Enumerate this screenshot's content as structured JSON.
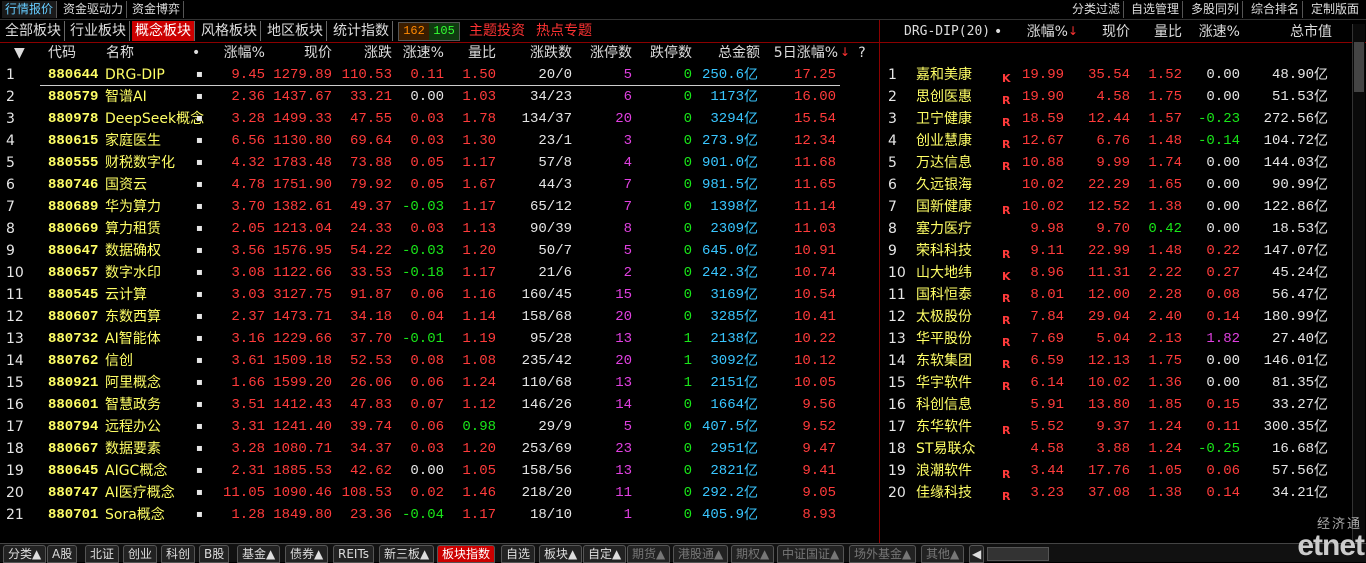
{
  "top_tabs": [
    "行情报价",
    "资金驱动力",
    "资金博弈"
  ],
  "top_right_tabs": [
    "分类过滤",
    "自选管理",
    "多股同列",
    "综合排名",
    "定制版面"
  ],
  "sec_tabs": [
    "全部板块",
    "行业板块",
    "概念板块",
    "风格板块",
    "地区板块",
    "统计指数"
  ],
  "sec_active": "概念板块",
  "sec_up_count": "162",
  "sec_down_count": "105",
  "sec_red_tabs": [
    "主题投资",
    "热点专题"
  ],
  "left_headers": {
    "sort": "▼",
    "code": "代码",
    "name": "名称",
    "dot": "•",
    "pct": "涨幅%",
    "price": "现价",
    "chg": "涨跌",
    "speed": "涨速%",
    "ratio": "量比",
    "updown": "涨跌数",
    "limitup": "涨停数",
    "limitdown": "跌停数",
    "amount": "总金额",
    "pct5": "5日涨幅%",
    "q": "?"
  },
  "left_rows": [
    {
      "idx": "1",
      "code": "880644",
      "name": "DRG-DIP",
      "pct": "9.45",
      "price": "1279.89",
      "chg": "110.53",
      "speed": "0.11",
      "ratio": "1.50",
      "updown": "20/0",
      "limitup": "5",
      "limitdown": "0",
      "amount": "250.6",
      "unit": "亿",
      "pct5": "17.25"
    },
    {
      "idx": "2",
      "code": "880579",
      "name": "智谱AI",
      "pct": "2.36",
      "price": "1437.67",
      "chg": "33.21",
      "speed": "0.00",
      "ratio": "1.03",
      "updown": "34/23",
      "limitup": "6",
      "limitdown": "0",
      "amount": "1173",
      "unit": "亿",
      "pct5": "16.00"
    },
    {
      "idx": "3",
      "code": "880978",
      "name": "DeepSeek概念",
      "pct": "3.28",
      "price": "1499.33",
      "chg": "47.55",
      "speed": "0.03",
      "ratio": "1.78",
      "updown": "134/37",
      "limitup": "20",
      "limitdown": "0",
      "amount": "3294",
      "unit": "亿",
      "pct5": "15.54"
    },
    {
      "idx": "4",
      "code": "880615",
      "name": "家庭医生",
      "pct": "6.56",
      "price": "1130.80",
      "chg": "69.64",
      "speed": "0.03",
      "ratio": "1.30",
      "updown": "23/1",
      "limitup": "3",
      "limitdown": "0",
      "amount": "273.9",
      "unit": "亿",
      "pct5": "12.34"
    },
    {
      "idx": "5",
      "code": "880555",
      "name": "财税数字化",
      "pct": "4.32",
      "price": "1783.48",
      "chg": "73.88",
      "speed": "0.05",
      "ratio": "1.17",
      "updown": "57/8",
      "limitup": "4",
      "limitdown": "0",
      "amount": "901.0",
      "unit": "亿",
      "pct5": "11.68"
    },
    {
      "idx": "6",
      "code": "880746",
      "name": "国资云",
      "pct": "4.78",
      "price": "1751.90",
      "chg": "79.92",
      "speed": "0.05",
      "ratio": "1.67",
      "updown": "44/3",
      "limitup": "7",
      "limitdown": "0",
      "amount": "981.5",
      "unit": "亿",
      "pct5": "11.65"
    },
    {
      "idx": "7",
      "code": "880689",
      "name": "华为算力",
      "pct": "3.70",
      "price": "1382.61",
      "chg": "49.37",
      "speed": "-0.03",
      "ratio": "1.17",
      "updown": "65/12",
      "limitup": "7",
      "limitdown": "0",
      "amount": "1398",
      "unit": "亿",
      "pct5": "11.14"
    },
    {
      "idx": "8",
      "code": "880669",
      "name": "算力租赁",
      "pct": "2.05",
      "price": "1213.04",
      "chg": "24.33",
      "speed": "0.03",
      "ratio": "1.13",
      "updown": "90/39",
      "limitup": "8",
      "limitdown": "0",
      "amount": "2309",
      "unit": "亿",
      "pct5": "11.03"
    },
    {
      "idx": "9",
      "code": "880647",
      "name": "数据确权",
      "pct": "3.56",
      "price": "1576.95",
      "chg": "54.22",
      "speed": "-0.03",
      "ratio": "1.20",
      "updown": "50/7",
      "limitup": "5",
      "limitdown": "0",
      "amount": "645.0",
      "unit": "亿",
      "pct5": "10.91"
    },
    {
      "idx": "10",
      "code": "880657",
      "name": "数字水印",
      "pct": "3.08",
      "price": "1122.66",
      "chg": "33.53",
      "speed": "-0.18",
      "ratio": "1.17",
      "updown": "21/6",
      "limitup": "2",
      "limitdown": "0",
      "amount": "242.3",
      "unit": "亿",
      "pct5": "10.74"
    },
    {
      "idx": "11",
      "code": "880545",
      "name": "云计算",
      "pct": "3.03",
      "price": "3127.75",
      "chg": "91.87",
      "speed": "0.06",
      "ratio": "1.16",
      "updown": "160/45",
      "limitup": "15",
      "limitdown": "0",
      "amount": "3169",
      "unit": "亿",
      "pct5": "10.54"
    },
    {
      "idx": "12",
      "code": "880607",
      "name": "东数西算",
      "pct": "2.37",
      "price": "1473.71",
      "chg": "34.18",
      "speed": "0.04",
      "ratio": "1.14",
      "updown": "158/68",
      "limitup": "20",
      "limitdown": "0",
      "amount": "3285",
      "unit": "亿",
      "pct5": "10.41"
    },
    {
      "idx": "13",
      "code": "880732",
      "name": "AI智能体",
      "pct": "3.16",
      "price": "1229.66",
      "chg": "37.70",
      "speed": "-0.01",
      "ratio": "1.19",
      "updown": "95/28",
      "limitup": "13",
      "limitdown": "1",
      "amount": "2138",
      "unit": "亿",
      "pct5": "10.22"
    },
    {
      "idx": "14",
      "code": "880762",
      "name": "信创",
      "pct": "3.61",
      "price": "1509.18",
      "chg": "52.53",
      "speed": "0.08",
      "ratio": "1.08",
      "updown": "235/42",
      "limitup": "20",
      "limitdown": "1",
      "amount": "3092",
      "unit": "亿",
      "pct5": "10.12"
    },
    {
      "idx": "15",
      "code": "880921",
      "name": "阿里概念",
      "pct": "1.66",
      "price": "1599.20",
      "chg": "26.06",
      "speed": "0.06",
      "ratio": "1.24",
      "updown": "110/68",
      "limitup": "13",
      "limitdown": "1",
      "amount": "2151",
      "unit": "亿",
      "pct5": "10.05"
    },
    {
      "idx": "16",
      "code": "880601",
      "name": "智慧政务",
      "pct": "3.51",
      "price": "1412.43",
      "chg": "47.83",
      "speed": "0.07",
      "ratio": "1.12",
      "updown": "146/26",
      "limitup": "14",
      "limitdown": "0",
      "amount": "1664",
      "unit": "亿",
      "pct5": "9.56"
    },
    {
      "idx": "17",
      "code": "880794",
      "name": "远程办公",
      "pct": "3.31",
      "price": "1241.40",
      "chg": "39.74",
      "speed": "0.06",
      "ratio": "0.98",
      "updown": "29/9",
      "limitup": "5",
      "limitdown": "0",
      "amount": "407.5",
      "unit": "亿",
      "pct5": "9.52"
    },
    {
      "idx": "18",
      "code": "880667",
      "name": "数据要素",
      "pct": "3.28",
      "price": "1080.71",
      "chg": "34.37",
      "speed": "0.03",
      "ratio": "1.20",
      "updown": "253/69",
      "limitup": "23",
      "limitdown": "0",
      "amount": "2951",
      "unit": "亿",
      "pct5": "9.47"
    },
    {
      "idx": "19",
      "code": "880645",
      "name": "AIGC概念",
      "pct": "2.31",
      "price": "1885.53",
      "chg": "42.62",
      "speed": "0.00",
      "ratio": "1.05",
      "updown": "158/56",
      "limitup": "13",
      "limitdown": "0",
      "amount": "2821",
      "unit": "亿",
      "pct5": "9.41"
    },
    {
      "idx": "20",
      "code": "880747",
      "name": "AI医疗概念",
      "pct": "11.05",
      "price": "1090.46",
      "chg": "108.53",
      "speed": "0.02",
      "ratio": "1.46",
      "updown": "218/20",
      "limitup": "11",
      "limitdown": "0",
      "amount": "292.2",
      "unit": "亿",
      "pct5": "9.05"
    },
    {
      "idx": "21",
      "code": "880701",
      "name": "Sora概念",
      "pct": "1.28",
      "price": "1849.80",
      "chg": "23.36",
      "speed": "-0.04",
      "ratio": "1.17",
      "updown": "18/10",
      "limitup": "1",
      "limitdown": "0",
      "amount": "405.9",
      "unit": "亿",
      "pct5": "8.93"
    }
  ],
  "right_headers": {
    "title": "DRG-DIP(20)",
    "dot": "•",
    "pct": "涨幅%",
    "price": "现价",
    "ratio": "量比",
    "speed": "涨速%",
    "cap": "总市值"
  },
  "right_rows": [
    {
      "idx": "1",
      "name": "嘉和美康",
      "flag": "K",
      "pct": "19.99",
      "price": "35.54",
      "ratio": "1.52",
      "speed": "0.00",
      "cap": "48.90",
      "unit": "亿"
    },
    {
      "idx": "2",
      "name": "思创医惠",
      "flag": "R",
      "pct": "19.90",
      "price": "4.58",
      "ratio": "1.75",
      "speed": "0.00",
      "cap": "51.53",
      "unit": "亿"
    },
    {
      "idx": "3",
      "name": "卫宁健康",
      "flag": "R",
      "pct": "18.59",
      "price": "12.44",
      "ratio": "1.57",
      "speed": "-0.23",
      "cap": "272.56",
      "unit": "亿"
    },
    {
      "idx": "4",
      "name": "创业慧康",
      "flag": "R",
      "pct": "12.67",
      "price": "6.76",
      "ratio": "1.48",
      "speed": "-0.14",
      "cap": "104.72",
      "unit": "亿"
    },
    {
      "idx": "5",
      "name": "万达信息",
      "flag": "R",
      "pct": "10.88",
      "price": "9.99",
      "ratio": "1.74",
      "speed": "0.00",
      "cap": "144.03",
      "unit": "亿"
    },
    {
      "idx": "6",
      "name": "久远银海",
      "flag": "",
      "pct": "10.02",
      "price": "22.29",
      "ratio": "1.65",
      "speed": "0.00",
      "cap": "90.99",
      "unit": "亿"
    },
    {
      "idx": "7",
      "name": "国新健康",
      "flag": "R",
      "pct": "10.02",
      "price": "12.52",
      "ratio": "1.38",
      "speed": "0.00",
      "cap": "122.86",
      "unit": "亿"
    },
    {
      "idx": "8",
      "name": "塞力医疗",
      "flag": "",
      "pct": "9.98",
      "price": "9.70",
      "ratio": "0.42",
      "speed": "0.00",
      "cap": "18.53",
      "unit": "亿"
    },
    {
      "idx": "9",
      "name": "荣科科技",
      "flag": "R",
      "pct": "9.11",
      "price": "22.99",
      "ratio": "1.48",
      "speed": "0.22",
      "cap": "147.07",
      "unit": "亿"
    },
    {
      "idx": "10",
      "name": "山大地纬",
      "flag": "K",
      "pct": "8.96",
      "price": "11.31",
      "ratio": "2.22",
      "speed": "0.27",
      "cap": "45.24",
      "unit": "亿"
    },
    {
      "idx": "11",
      "name": "国科恒泰",
      "flag": "R",
      "pct": "8.01",
      "price": "12.00",
      "ratio": "2.28",
      "speed": "0.08",
      "cap": "56.47",
      "unit": "亿"
    },
    {
      "idx": "12",
      "name": "太极股份",
      "flag": "R",
      "pct": "7.84",
      "price": "29.04",
      "ratio": "2.40",
      "speed": "0.14",
      "cap": "180.99",
      "unit": "亿"
    },
    {
      "idx": "13",
      "name": "华平股份",
      "flag": "R",
      "pct": "7.69",
      "price": "5.04",
      "ratio": "2.13",
      "speed": "1.82",
      "cap": "27.40",
      "unit": "亿"
    },
    {
      "idx": "14",
      "name": "东软集团",
      "flag": "R",
      "pct": "6.59",
      "price": "12.13",
      "ratio": "1.75",
      "speed": "0.00",
      "cap": "146.01",
      "unit": "亿"
    },
    {
      "idx": "15",
      "name": "华宇软件",
      "flag": "R",
      "pct": "6.14",
      "price": "10.02",
      "ratio": "1.36",
      "speed": "0.00",
      "cap": "81.35",
      "unit": "亿"
    },
    {
      "idx": "16",
      "name": "科创信息",
      "flag": "",
      "pct": "5.91",
      "price": "13.80",
      "ratio": "1.85",
      "speed": "0.15",
      "cap": "33.27",
      "unit": "亿"
    },
    {
      "idx": "17",
      "name": "东华软件",
      "flag": "R",
      "pct": "5.52",
      "price": "9.37",
      "ratio": "1.24",
      "speed": "0.11",
      "cap": "300.35",
      "unit": "亿"
    },
    {
      "idx": "18",
      "name": "ST易联众",
      "flag": "",
      "pct": "4.58",
      "price": "3.88",
      "ratio": "1.24",
      "speed": "-0.25",
      "cap": "16.68",
      "unit": "亿"
    },
    {
      "idx": "19",
      "name": "浪潮软件",
      "flag": "R",
      "pct": "3.44",
      "price": "17.76",
      "ratio": "1.05",
      "speed": "0.06",
      "cap": "57.56",
      "unit": "亿"
    },
    {
      "idx": "20",
      "name": "佳缘科技",
      "flag": "R",
      "pct": "3.23",
      "price": "37.08",
      "ratio": "1.38",
      "speed": "0.14",
      "cap": "34.21",
      "unit": "亿"
    }
  ],
  "bottom_tabs": [
    {
      "label": "分类▲",
      "active": false,
      "dim": false
    },
    {
      "label": "A股",
      "active": false,
      "dim": false
    },
    {
      "label": "北证",
      "active": false,
      "dim": false
    },
    {
      "label": "创业",
      "active": false,
      "dim": false
    },
    {
      "label": "科创",
      "active": false,
      "dim": false
    },
    {
      "label": "B股",
      "active": false,
      "dim": false
    },
    {
      "label": "基金▲",
      "active": false,
      "dim": false
    },
    {
      "label": "债券▲",
      "active": false,
      "dim": false
    },
    {
      "label": "REITs",
      "active": false,
      "dim": false
    },
    {
      "label": "新三板▲",
      "active": false,
      "dim": false
    },
    {
      "label": "板块指数",
      "active": true,
      "dim": false
    },
    {
      "label": "自选",
      "active": false,
      "dim": false
    },
    {
      "label": "板块▲",
      "active": false,
      "dim": false
    },
    {
      "label": "自定▲",
      "active": false,
      "dim": false
    },
    {
      "label": "期货▲",
      "active": false,
      "dim": true
    },
    {
      "label": "港股通▲",
      "active": false,
      "dim": true
    },
    {
      "label": "期权▲",
      "active": false,
      "dim": true
    },
    {
      "label": "中证国证▲",
      "active": false,
      "dim": true
    },
    {
      "label": "场外基金▲",
      "active": false,
      "dim": true
    },
    {
      "label": "其他▲",
      "active": false,
      "dim": true
    }
  ],
  "logo_text": "经济通",
  "logo_brand": "etnet",
  "colors": {
    "up": "#ff3b3b",
    "down": "#19e619",
    "code": "#ffff66",
    "amount": "#39c6ff",
    "limit": "#e040e0",
    "active_tab": "#cc0000"
  }
}
